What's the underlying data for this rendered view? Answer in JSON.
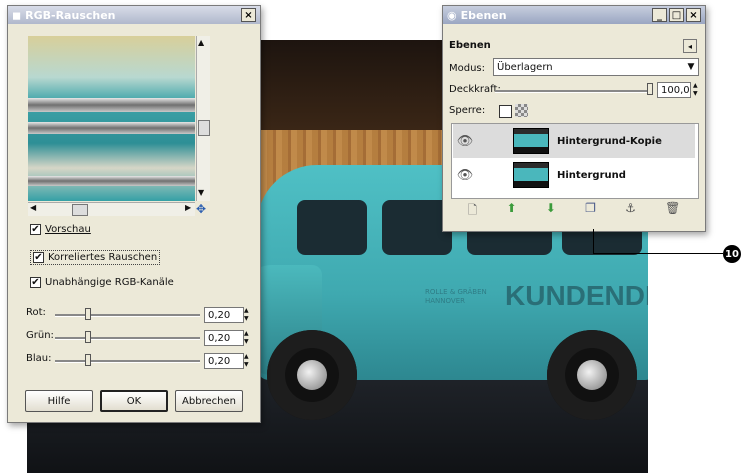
{
  "rgb_dialog": {
    "title": "RGB-Rauschen",
    "close": "×",
    "preview_checkbox": "Vorschau",
    "correlated_checkbox": "Korreliertes Rauschen",
    "independent_checkbox": "Unabhängige RGB-Kanäle",
    "sliders": [
      {
        "label": "Rot:",
        "value": "0,20"
      },
      {
        "label": "Grün:",
        "value": "0,20"
      },
      {
        "label": "Blau:",
        "value": "0,20"
      }
    ],
    "buttons": {
      "help": "Hilfe",
      "ok": "OK",
      "cancel": "Abbrechen"
    }
  },
  "layers_dialog": {
    "title": "Ebenen",
    "subtitle": "Ebenen",
    "mode_label": "Modus:",
    "mode_value": "Überlagern",
    "opacity_label": "Deckkraft:",
    "opacity_value": "100,0",
    "lock_label": "Sperre:",
    "window_buttons": [
      "_",
      "□",
      "×"
    ],
    "layers": [
      {
        "name": "Hintergrund-Kopie",
        "visible": true,
        "selected": true
      },
      {
        "name": "Hintergrund",
        "visible": true,
        "selected": false
      }
    ],
    "toolbar_icons": [
      "new-layer-icon",
      "raise-layer-icon",
      "lower-layer-icon",
      "duplicate-layer-icon",
      "anchor-layer-icon",
      "delete-layer-icon"
    ]
  },
  "photo": {
    "van_text": "KUNDENDIENS",
    "small_text": "ROLLE & GRÄBEN HANNOVER"
  },
  "callout": {
    "number": "10"
  }
}
